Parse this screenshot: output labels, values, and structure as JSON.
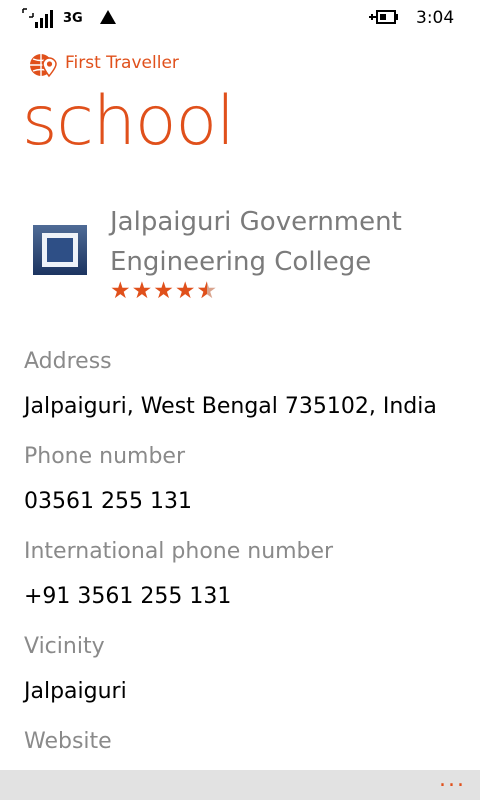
{
  "status_bar": {
    "network": "3G",
    "time": "3:04"
  },
  "app": {
    "name": "First Traveller",
    "accent_color": "#e0501b"
  },
  "page": {
    "title": "school"
  },
  "place": {
    "name_line1": "Jalpaiguri Government",
    "name_line2": "Engineering College",
    "rating_stars": 4.5,
    "rating_max": 5
  },
  "details": [
    {
      "label": "Address",
      "value": "Jalpaiguri, West Bengal 735102, India"
    },
    {
      "label": "Phone number",
      "value": "03561 255 131"
    },
    {
      "label": "International phone number",
      "value": "+91 3561 255 131"
    },
    {
      "label": "Vicinity",
      "value": "Jalpaiguri"
    },
    {
      "label": "Website",
      "value": ""
    }
  ],
  "app_bar": {
    "more_label": "..."
  }
}
